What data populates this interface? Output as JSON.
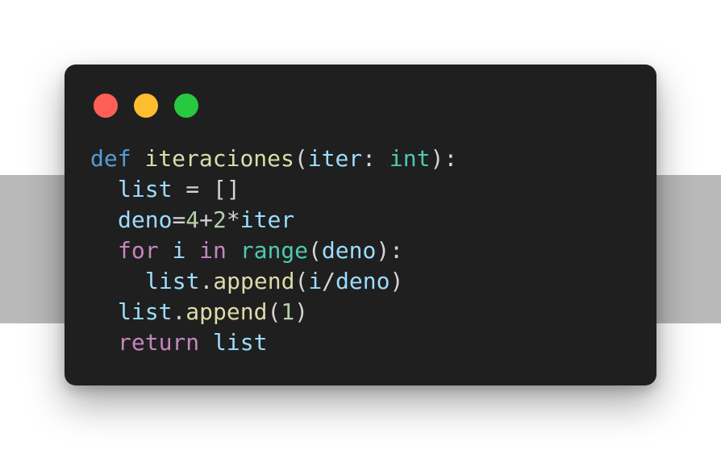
{
  "colors": {
    "window_bg": "#1f1f1f",
    "band": "#b9b9b9",
    "keyword_def": "#569cd6",
    "keyword_control": "#c586c0",
    "function": "#dcdcaa",
    "variable": "#9cdcfe",
    "type": "#4ec9b0",
    "number": "#b5cea8",
    "punctuation": "#d4d4d4"
  },
  "window_controls": [
    "close-dot",
    "minimize-dot",
    "maximize-dot"
  ],
  "code": {
    "l1": {
      "kw": "def",
      "fn": "iteraciones",
      "p1": "(",
      "param": "iter",
      "colon": ":",
      "type": "int",
      "p2": "):"
    },
    "l2": {
      "var": "list",
      "op": "=",
      "val": "[]"
    },
    "l3": {
      "var": "deno",
      "eq": "=",
      "n1": "4",
      "plus": "+",
      "n2": "2",
      "mul": "*",
      "var2": "iter"
    },
    "l4": {
      "kw": "for",
      "var": "i",
      "kw2": "in",
      "fn": "range",
      "p1": "(",
      "arg": "deno",
      "p2": "):"
    },
    "l5": {
      "obj": "list",
      "dot": ".",
      "fn": "append",
      "p1": "(",
      "a": "i",
      "slash": "/",
      "b": "deno",
      "p2": ")"
    },
    "l6": {
      "obj": "list",
      "dot": ".",
      "fn": "append",
      "p1": "(",
      "n": "1",
      "p2": ")"
    },
    "l7": {
      "kw": "return",
      "var": "list"
    }
  }
}
